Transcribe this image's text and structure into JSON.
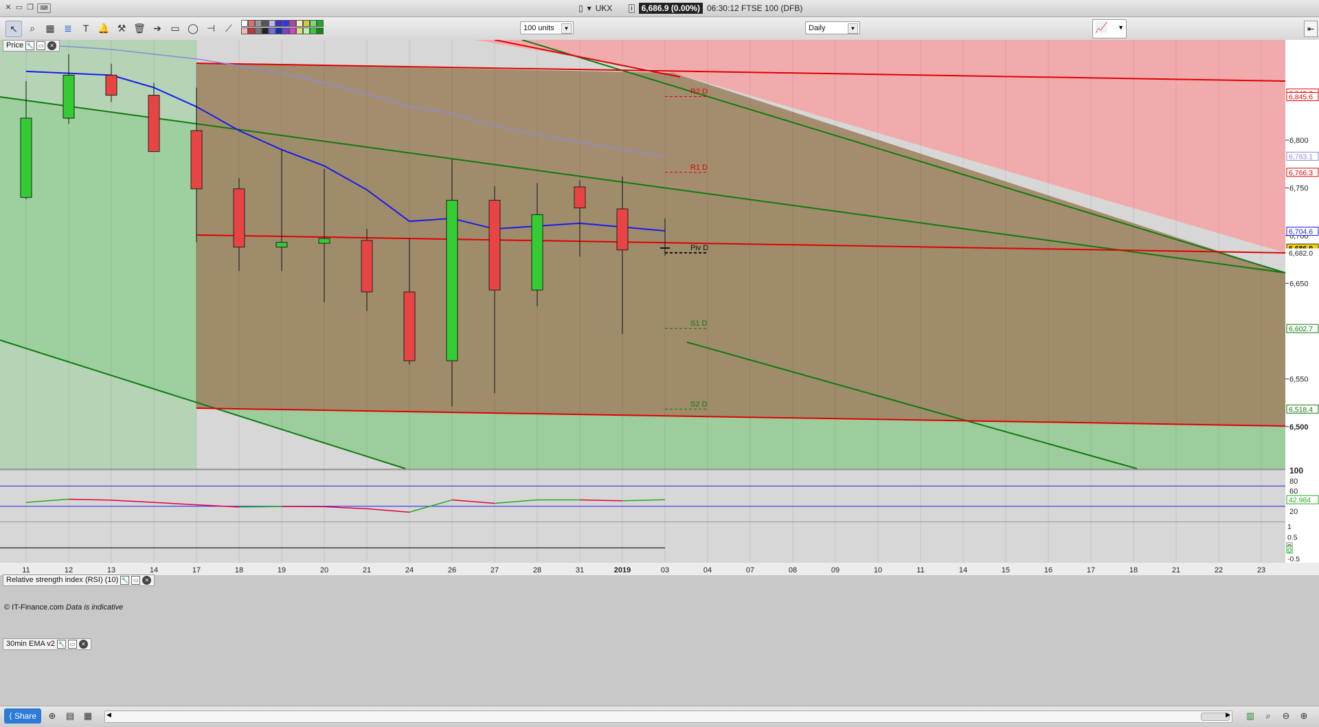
{
  "window": {
    "symbol": "UKX",
    "quote": "6,686.9 (0.00%)",
    "time_desc": "06:30:12 FTSE 100 (DFB)"
  },
  "toolbar": {
    "units_select": "100 units",
    "interval_select": "Daily"
  },
  "panels": {
    "price": "Price",
    "rsi": "Relative strength index (RSI) (10)",
    "ema": "30min EMA v2"
  },
  "copyright": "© IT-Finance.com",
  "disclaimer": "Data is indicative",
  "share_label": "Share",
  "colors": {
    "up": "#33cc33",
    "down": "#e84444",
    "channel_red": "#e00000",
    "channel_green": "#0d7a0d",
    "ema_blue": "#1a1aee",
    "ema_light": "#8a8ad8"
  },
  "chart_data": {
    "type": "candlestick",
    "x_labels": [
      "11",
      "12",
      "13",
      "14",
      "17",
      "18",
      "19",
      "20",
      "21",
      "24",
      "26",
      "27",
      "28",
      "31",
      "2019",
      "03",
      "04",
      "07",
      "08",
      "09",
      "10",
      "11",
      "14",
      "15",
      "16",
      "17",
      "18",
      "21",
      "22",
      "23"
    ],
    "candles": [
      {
        "d": "11",
        "o": 6740,
        "h": 6862,
        "l": 6738,
        "c": 6823
      },
      {
        "d": "12",
        "o": 6823,
        "h": 6890,
        "l": 6817,
        "c": 6868
      },
      {
        "d": "13",
        "o": 6868,
        "h": 6880,
        "l": 6840,
        "c": 6847
      },
      {
        "d": "14",
        "o": 6847,
        "h": 6860,
        "l": 6790,
        "c": 6788
      },
      {
        "d": "17",
        "o": 6810,
        "h": 6855,
        "l": 6693,
        "c": 6749
      },
      {
        "d": "18",
        "o": 6749,
        "h": 6760,
        "l": 6663,
        "c": 6688
      },
      {
        "d": "19",
        "o": 6688,
        "h": 6790,
        "l": 6663,
        "c": 6693
      },
      {
        "d": "20",
        "o": 6692,
        "h": 6770,
        "l": 6630,
        "c": 6697
      },
      {
        "d": "21",
        "o": 6695,
        "h": 6707,
        "l": 6621,
        "c": 6641
      },
      {
        "d": "24",
        "o": 6641,
        "h": 6697,
        "l": 6565,
        "c": 6569
      },
      {
        "d": "26",
        "o": 6569,
        "h": 6780,
        "l": 6521,
        "c": 6737
      },
      {
        "d": "27",
        "o": 6737,
        "h": 6752,
        "l": 6535,
        "c": 6643
      },
      {
        "d": "28",
        "o": 6643,
        "h": 6755,
        "l": 6626,
        "c": 6722
      },
      {
        "d": "31",
        "o": 6751,
        "h": 6758,
        "l": 6678,
        "c": 6729
      },
      {
        "d": "2019",
        "o": 6728,
        "h": 6762,
        "l": 6597,
        "c": 6685
      },
      {
        "d": "03",
        "o": 6687,
        "h": 6718,
        "l": 6679,
        "c": 6687
      }
    ],
    "ema_fast": [
      6872,
      6870,
      6868,
      6855,
      6835,
      6810,
      6790,
      6773,
      6748,
      6715,
      6718,
      6707,
      6710,
      6713,
      6709,
      6705
    ],
    "ema_slow": [
      6900,
      6898,
      6895,
      6890,
      6885,
      6878,
      6870,
      6860,
      6848,
      6835,
      6828,
      6815,
      6806,
      6798,
      6790,
      6783
    ],
    "pivots": [
      {
        "label": "R2 D",
        "value": 6845.6
      },
      {
        "label": "R1 D",
        "value": 6766.3
      },
      {
        "label": "Piv D",
        "value": 6682.0
      },
      {
        "label": "S1 D",
        "value": 6602.7
      },
      {
        "label": "S2 D",
        "value": 6518.4
      }
    ],
    "y_ticks": [
      "6,800",
      "6,750",
      "6,700",
      "6,650",
      "6,550",
      "6,500"
    ],
    "price_tags": [
      {
        "text": "6,849.3",
        "value": 6849.3,
        "kind": "red"
      },
      {
        "text": "6,845.6",
        "value": 6845.6,
        "kind": "red"
      },
      {
        "text": "6,783.1",
        "value": 6783.1,
        "kind": "slow"
      },
      {
        "text": "6,766.3",
        "value": 6766.3,
        "kind": "red"
      },
      {
        "text": "6,704.6",
        "value": 6704.6,
        "kind": "blue"
      },
      {
        "text": "6,686.9",
        "value": 6686.9,
        "kind": "current"
      },
      {
        "text": "6,682.0",
        "value": 6682.0,
        "kind": "plain"
      },
      {
        "text": "6,602.7",
        "value": 6602.7,
        "kind": "green"
      },
      {
        "text": "6,518.4",
        "value": 6518.4,
        "kind": "green"
      }
    ],
    "ylim": [
      6456,
      6905
    ],
    "rsi": {
      "values": [
        37.6,
        43.9,
        42.1,
        37.6,
        33.0,
        28.5,
        29.6,
        29.2,
        25.1,
        18.4,
        42.5,
        35.8,
        42.6,
        42.6,
        40.8,
        42.984
      ],
      "levels": [
        70,
        30
      ],
      "y_labels": [
        "100",
        "80",
        "60",
        "20"
      ],
      "current": "42.984"
    },
    "ema_panel": {
      "y_labels": [
        "1",
        "0.5",
        "0",
        "0",
        "-0.5"
      ]
    }
  }
}
